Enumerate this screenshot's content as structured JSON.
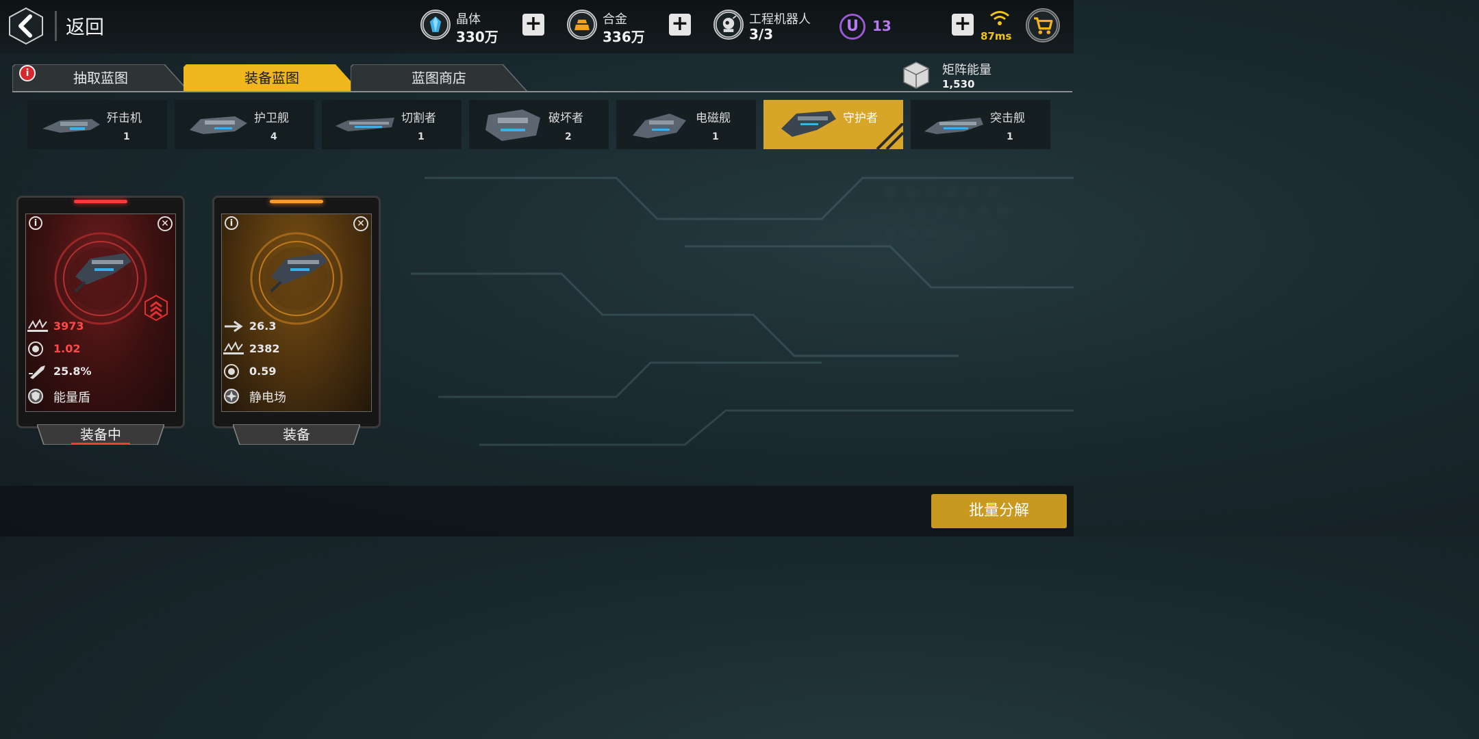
{
  "header": {
    "back_label": "返回",
    "resources": [
      {
        "name": "晶体",
        "value": "330万",
        "icon": "crystal-icon",
        "color": "#3ab0e8"
      },
      {
        "name": "合金",
        "value": "336万",
        "icon": "alloy-icon",
        "color": "#f3a21a"
      },
      {
        "name": "工程机器人",
        "value": "3/3",
        "icon": "robot-icon",
        "color": "#cfcfcf"
      }
    ],
    "plus_symbol": "+",
    "u_letter": "U",
    "u_count": "13",
    "ping": "87ms"
  },
  "tabs": [
    {
      "label": "抽取蓝图",
      "active": false,
      "alert": "i"
    },
    {
      "label": "装备蓝图",
      "active": true
    },
    {
      "label": "蓝图商店",
      "active": false
    }
  ],
  "matrix": {
    "label": "矩阵能量",
    "value": "1,530"
  },
  "ships": [
    {
      "name": "歼击机",
      "count": "1",
      "active": false
    },
    {
      "name": "护卫舰",
      "count": "4",
      "active": false
    },
    {
      "name": "切割者",
      "count": "1",
      "active": false
    },
    {
      "name": "破坏者",
      "count": "2",
      "active": false
    },
    {
      "name": "电磁舰",
      "count": "1",
      "active": false
    },
    {
      "name": "守护者",
      "count": "",
      "active": true
    },
    {
      "name": "突击舰",
      "count": "1",
      "active": false
    }
  ],
  "cards": [
    {
      "theme": "red",
      "info": "i",
      "close": "✕",
      "stats": [
        {
          "icon": "armor-icon",
          "value": "3973"
        },
        {
          "icon": "energy-icon",
          "value": "1.02"
        },
        {
          "icon": "missile-icon",
          "value": "25.8%"
        }
      ],
      "skill": {
        "icon": "shield-icon",
        "label": "能量盾"
      },
      "button": "装备中",
      "rank_icon": "rank-chevron-icon"
    },
    {
      "theme": "gold",
      "info": "i",
      "close": "✕",
      "stats": [
        {
          "icon": "speed-icon",
          "value": "26.3"
        },
        {
          "icon": "armor-icon",
          "value": "2382"
        },
        {
          "icon": "energy-icon",
          "value": "0.59"
        }
      ],
      "skill": {
        "icon": "static-field-icon",
        "label": "静电场"
      },
      "button": "装备"
    }
  ],
  "footer": {
    "decompose_label": "批量分解"
  },
  "colors": {
    "accent_gold": "#d7a527",
    "card_red": "#ff4a4a",
    "purple": "#b57af0",
    "ping_yellow": "#f2c31a"
  }
}
